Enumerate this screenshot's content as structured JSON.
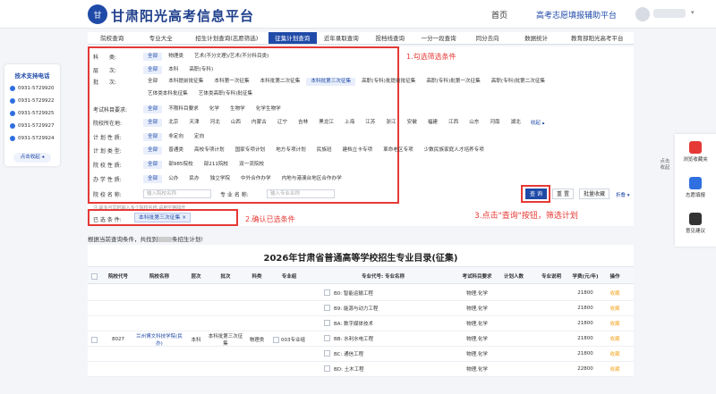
{
  "header": {
    "logo_glyph": "甘",
    "site_title": "甘肃阳光高考信息平台",
    "nav_home": "首页",
    "nav_assist": "高考志愿填报辅助平台",
    "caret": "▾"
  },
  "tabs": [
    "院校查询",
    "专业大全",
    "招生计划查询(志愿筛选)",
    "征集计划查询",
    "近年录取查询",
    "投档线查询",
    "一分一段查询",
    "同分去向",
    "数据统计",
    "教育部阳光高考平台"
  ],
  "active_tab_index": 3,
  "filters": {
    "rows": [
      {
        "label": "科　　类:",
        "options": [
          "全部",
          "物理类",
          "艺术(不分文理)/艺术(不分科目类)"
        ],
        "selected": 0
      },
      {
        "label": "层　　次:",
        "options": [
          "全部",
          "本科",
          "高职(专科)"
        ],
        "selected": 0
      },
      {
        "label": "批　　次:",
        "options": [
          "全部",
          "本科提前批征集",
          "本科第一次征集",
          "本科批第二次征集",
          "本科批第三次征集",
          "高职(专科)批提前批征集",
          "高职(专科)批第一次征集",
          "高职(专科)批第二次征集"
        ],
        "selected": 4
      },
      {
        "label": "",
        "options": [
          "艺体类本科批征集",
          "艺体类高职(专科)批征集"
        ],
        "selected": -1
      },
      {
        "label": "考试科目要求:",
        "options": [
          "全部",
          "不限科目要求",
          "化学",
          "生物学",
          "化学生物学"
        ],
        "selected": 0
      },
      {
        "label": "院校所在地:",
        "options": [
          "全部",
          "北京",
          "天津",
          "河北",
          "山西",
          "内蒙古",
          "辽宁",
          "吉林",
          "黑龙江",
          "上海",
          "江苏",
          "浙江",
          "安徽",
          "福建",
          "江西",
          "山东",
          "河南",
          "湖北"
        ],
        "selected": 0
      },
      {
        "label": "计 划 性 质:",
        "options": [
          "全部",
          "非定向",
          "定向"
        ],
        "selected": 0
      },
      {
        "label": "计 划 类 型:",
        "options": [
          "全部",
          "普通类",
          "高校专项计划",
          "国家专项计划",
          "地方专项计划",
          "民族班",
          "建档立卡专项",
          "革命老区专项",
          "少数民族家庭人才培养专项"
        ],
        "selected": 0
      },
      {
        "label": "院 校 性 质:",
        "options": [
          "全部",
          "部985院校",
          "部211院校",
          "双一流院校"
        ],
        "selected": 0
      },
      {
        "label": "办 学 性 质:",
        "options": [
          "全部",
          "公办",
          "民办",
          "独立学院",
          "中外合作办学",
          "内地与港澳台地区合作办学"
        ],
        "selected": 0
      }
    ],
    "more_label": "收起 ▴",
    "school_name_label": "院 校 名 称:",
    "school_name_placeholder": "输入院校名称",
    "major_name_label": "专 业 名 称:",
    "major_name_placeholder": "输入专业名称",
    "hint": "注:最多可同时输入多个院校名称,请用空格隔开",
    "btn_query": "查 询",
    "btn_reset": "重 置",
    "btn_batch_fav": "批量收藏",
    "fold_label": "折叠 ▾"
  },
  "selected": {
    "label": "已 选 条 件:",
    "chip": "本科批第三次征集 ×"
  },
  "annotations": {
    "a1": "1.勾选筛选条件",
    "a2": "2.确认已选条件",
    "a3": "3.点击\"查询\"按钮，筛选计划"
  },
  "result": {
    "prefix": "根据当前查询条件，共找到",
    "suffix": "条招生计划!"
  },
  "table": {
    "title": "2026年甘肃省普通高等学校招生专业目录(征集)",
    "headers": [
      "院校代号",
      "院校名称",
      "层次",
      "批次",
      "科类",
      "专业组",
      "专业代号: 专业名称",
      "考试科目要求",
      "计划人数",
      "专业说明",
      "学费(元/年)",
      "操作"
    ],
    "school_code": "8027",
    "school_name": "兰州博文科技学院(民办)",
    "level": "本科",
    "batch": "本科批第三次征集",
    "category": "物理类",
    "group": "003专业组",
    "rows": [
      {
        "major": "B0: 智能运输工程",
        "req": "物理,化学",
        "plan": "",
        "fee": "21800",
        "op": "收藏"
      },
      {
        "major": "B9: 能源与动力工程",
        "req": "物理,化学",
        "plan": "",
        "fee": "21800",
        "op": "收藏"
      },
      {
        "major": "BA: 数字媒体技术",
        "req": "物理,化学",
        "plan": "",
        "fee": "21800",
        "op": "收藏"
      },
      {
        "major": "BB: 水利水电工程",
        "req": "物理,化学",
        "plan": "",
        "fee": "21800",
        "op": "收藏"
      },
      {
        "major": "BC: 通信工程",
        "req": "物理,化学",
        "plan": "",
        "fee": "21800",
        "op": "收藏"
      },
      {
        "major": "BD: 土木工程",
        "req": "物理,化学",
        "plan": "",
        "fee": "22800",
        "op": "收藏"
      }
    ]
  },
  "left_sidebar": {
    "title": "技术支持电话",
    "phones": [
      "0931-5729920",
      "0931-5729922",
      "0931-5729925",
      "0931-5729927",
      "0931-5729924"
    ],
    "collapse": "点击收起 ◂"
  },
  "right_sidebar": {
    "side_text": "点击收起",
    "items": [
      {
        "label": "浏览收藏夹",
        "color": "#e53935"
      },
      {
        "label": "志愿填报",
        "color": "#2f6fe0"
      },
      {
        "label": "意见建议",
        "color": "#333333"
      }
    ]
  }
}
